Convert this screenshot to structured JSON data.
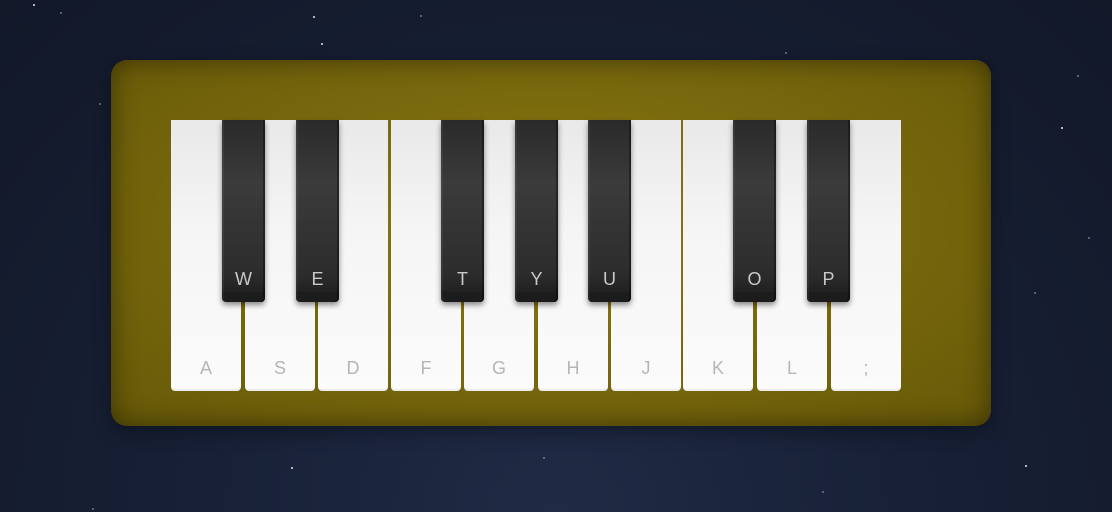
{
  "piano": {
    "body_color": "#7a6a0e",
    "white_keys": [
      {
        "label": "A"
      },
      {
        "label": "S"
      },
      {
        "label": "D"
      },
      {
        "label": "F"
      },
      {
        "label": "G"
      },
      {
        "label": "H"
      },
      {
        "label": "J"
      },
      {
        "label": "K"
      },
      {
        "label": "L"
      },
      {
        "label": ";"
      }
    ],
    "black_keys": [
      {
        "label": "W"
      },
      {
        "label": "E"
      },
      {
        "label": "T"
      },
      {
        "label": "Y"
      },
      {
        "label": "U"
      },
      {
        "label": "O"
      },
      {
        "label": "P"
      }
    ]
  }
}
